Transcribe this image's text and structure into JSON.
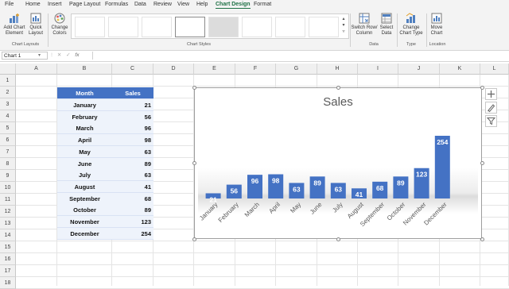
{
  "ribbon": {
    "tabs": [
      {
        "label": "File"
      },
      {
        "label": "Home"
      },
      {
        "label": "Insert"
      },
      {
        "label": "Page Layout"
      },
      {
        "label": "Formulas"
      },
      {
        "label": "Data"
      },
      {
        "label": "Review"
      },
      {
        "label": "View"
      },
      {
        "label": "Help"
      },
      {
        "label": "Chart Design"
      },
      {
        "label": "Format"
      }
    ],
    "active_tab": "Chart Design",
    "add_chart_element": "Add Chart Element",
    "quick_layout": "Quick Layout",
    "change_colors": "Change Colors",
    "switch_row_column": "Switch Row/ Column",
    "select_data": "Select Data",
    "change_chart_type": "Change Chart Type",
    "move_chart": "Move Chart",
    "groups": {
      "chart_layouts": "Chart Layouts",
      "chart_styles": "Chart Styles",
      "data": "Data",
      "type": "Type",
      "location": "Location"
    }
  },
  "formula_bar": {
    "name_box": "Chart 1",
    "fx_label": "fx"
  },
  "grid": {
    "columns": [
      "A",
      "B",
      "C",
      "D",
      "E",
      "F",
      "G",
      "H",
      "I",
      "J",
      "K",
      "L"
    ],
    "rows": [
      "1",
      "2",
      "3",
      "4",
      "5",
      "6",
      "7",
      "8",
      "9",
      "10",
      "11",
      "12",
      "13",
      "14",
      "15",
      "16",
      "17",
      "18"
    ]
  },
  "table": {
    "headers": {
      "month": "Month",
      "sales": "Sales"
    },
    "rows": [
      {
        "month": "January",
        "sales": "21"
      },
      {
        "month": "February",
        "sales": "56"
      },
      {
        "month": "March",
        "sales": "96"
      },
      {
        "month": "April",
        "sales": "98"
      },
      {
        "month": "May",
        "sales": "63"
      },
      {
        "month": "June",
        "sales": "89"
      },
      {
        "month": "July",
        "sales": "63"
      },
      {
        "month": "August",
        "sales": "41"
      },
      {
        "month": "September",
        "sales": "68"
      },
      {
        "month": "October",
        "sales": "89"
      },
      {
        "month": "November",
        "sales": "123"
      },
      {
        "month": "December",
        "sales": "254"
      }
    ]
  },
  "chart_data": {
    "type": "bar",
    "title": "Sales",
    "categories": [
      "January",
      "February",
      "March",
      "April",
      "May",
      "June",
      "July",
      "August",
      "September",
      "October",
      "November",
      "December"
    ],
    "values": [
      21,
      56,
      96,
      98,
      63,
      89,
      63,
      41,
      68,
      89,
      123,
      254
    ],
    "bar_color": "#4472c4",
    "label_color": "#ffffff",
    "ylim": [
      0,
      254
    ],
    "grid": false,
    "legend": "none"
  },
  "colors": {
    "accent": "#1e7145",
    "table_header": "#4472c4"
  }
}
